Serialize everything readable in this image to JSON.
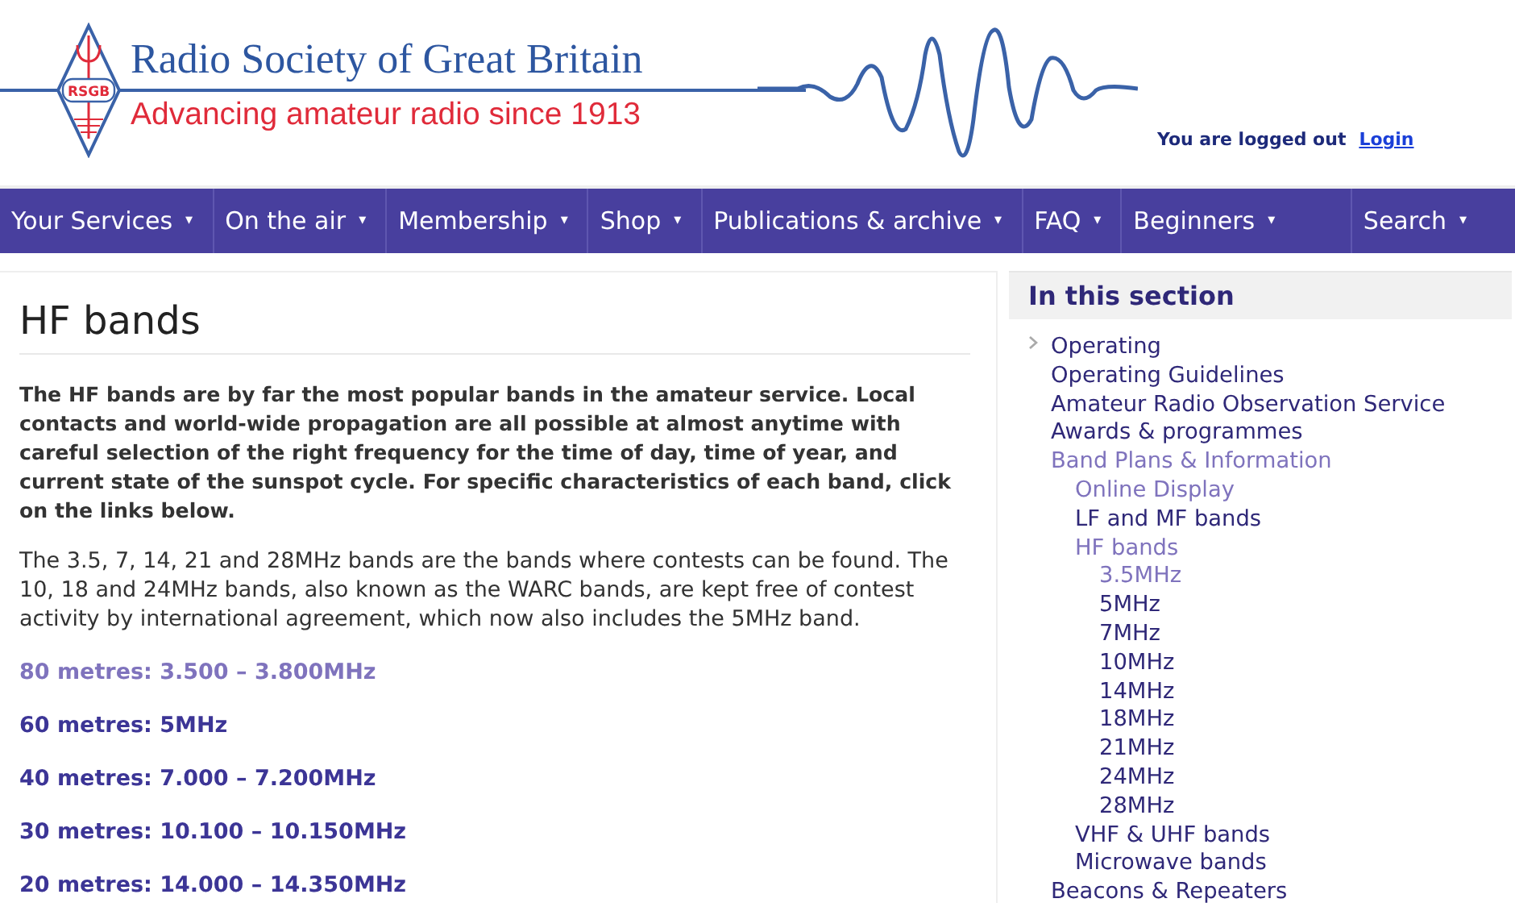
{
  "header": {
    "logo_text": "RSGB",
    "title": "Radio Society of Great Britain",
    "tagline": "Advancing amateur radio since 1913",
    "login_status": "You are logged out",
    "login_link": "Login"
  },
  "nav": [
    {
      "label": "Your Services",
      "caret": "▾"
    },
    {
      "label": "On the air",
      "caret": "▾"
    },
    {
      "label": "Membership",
      "caret": "▾"
    },
    {
      "label": "Shop",
      "caret": "▾"
    },
    {
      "label": "Publications & archive",
      "caret": "▾"
    },
    {
      "label": "FAQ",
      "caret": "▾"
    },
    {
      "label": "Beginners",
      "caret": "▾"
    },
    {
      "label": "Search",
      "caret": "▾"
    }
  ],
  "main": {
    "heading": "HF bands",
    "intro": "The HF bands are by far the most popular bands in the amateur service. Local contacts and world-wide propagation are all possible at almost anytime with careful selection of the right frequency for the time of day, time of year, and current state of the sunspot cycle. For specific characteristics of each band, click on the links below.",
    "body": "The 3.5, 7, 14, 21 and 28MHz bands are the bands where contests can be found. The 10, 18 and 24MHz bands, also known as the WARC bands, are kept free of contest activity by international agreement, which now also includes the 5MHz band.",
    "band_links": [
      {
        "label": "80 metres: 3.500 – 3.800MHz",
        "visited": true
      },
      {
        "label": "60 metres: 5MHz",
        "visited": false
      },
      {
        "label": "40 metres: 7.000 – 7.200MHz",
        "visited": false
      },
      {
        "label": "30 metres: 10.100 – 10.150MHz",
        "visited": false
      },
      {
        "label": "20 metres: 14.000 – 14.350MHz",
        "visited": false
      }
    ]
  },
  "sidebar": {
    "title": "In this section",
    "items": [
      {
        "label": "Operating",
        "visited": false,
        "has_chevron": true
      },
      {
        "label": "Operating Guidelines",
        "visited": false
      },
      {
        "label": "Amateur Radio Observation Service",
        "visited": false
      },
      {
        "label": "Awards & programmes",
        "visited": false
      },
      {
        "label": "Band Plans & Information",
        "visited": true,
        "children": [
          {
            "label": "Online Display",
            "visited": true
          },
          {
            "label": "LF and MF bands",
            "visited": false
          },
          {
            "label": "HF bands",
            "visited": true,
            "children": [
              {
                "label": "3.5MHz",
                "visited": true
              },
              {
                "label": "5MHz",
                "visited": false
              },
              {
                "label": "7MHz",
                "visited": false
              },
              {
                "label": "10MHz",
                "visited": false
              },
              {
                "label": "14MHz",
                "visited": false
              },
              {
                "label": "18MHz",
                "visited": false
              },
              {
                "label": "21MHz",
                "visited": false
              },
              {
                "label": "24MHz",
                "visited": false
              },
              {
                "label": "28MHz",
                "visited": false
              }
            ]
          },
          {
            "label": "VHF & UHF bands",
            "visited": false
          },
          {
            "label": "Microwave bands",
            "visited": false
          }
        ]
      },
      {
        "label": "Beacons & Repeaters",
        "visited": false
      }
    ]
  }
}
